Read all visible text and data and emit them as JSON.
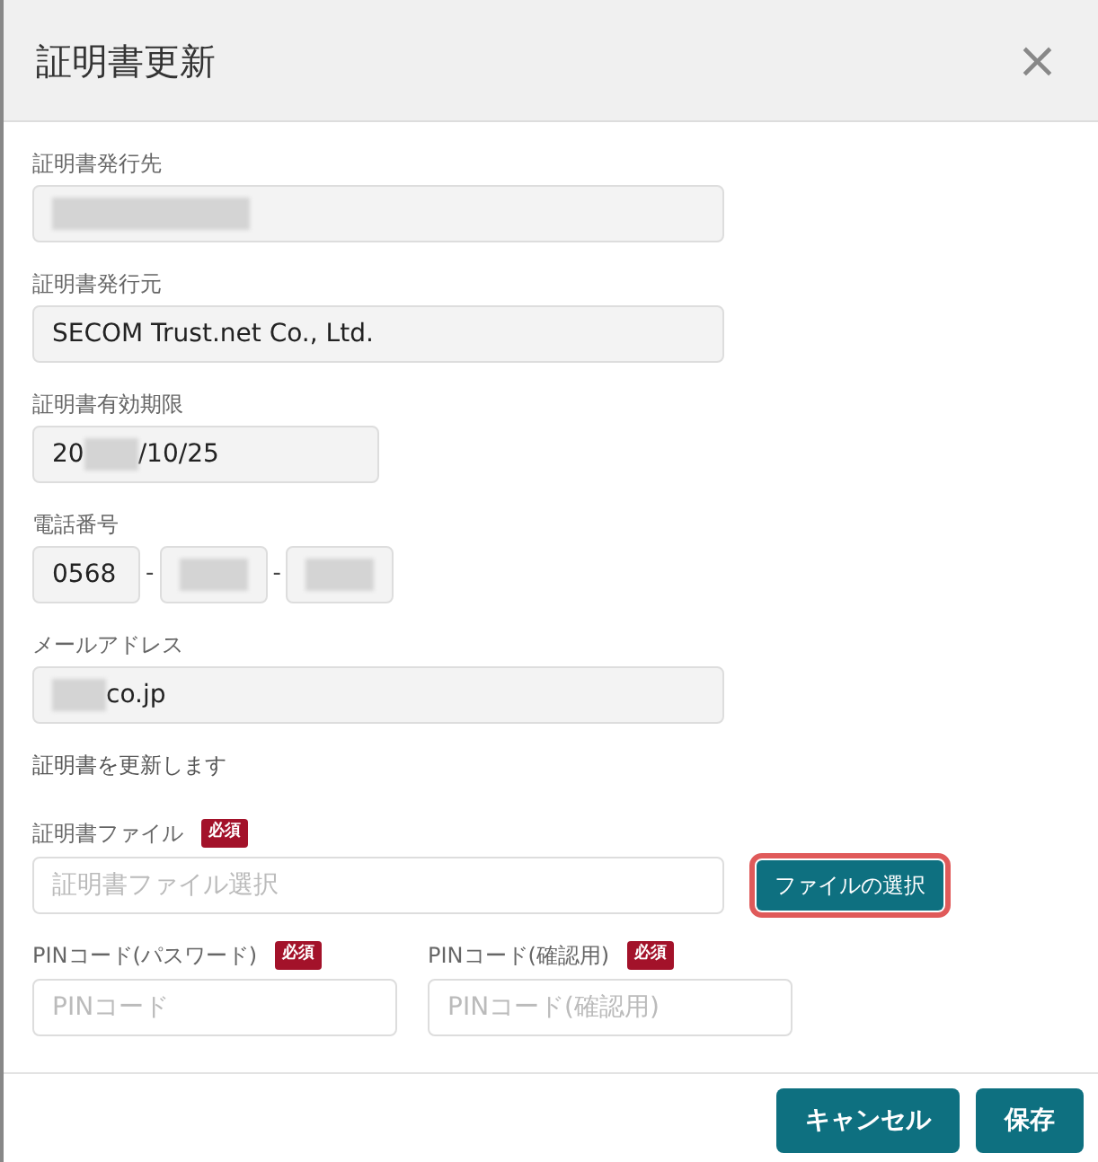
{
  "dialog": {
    "title": "証明書更新",
    "close": "×"
  },
  "fields": [
    {
      "kind": "text",
      "label": "証明書発行先",
      "segments": [
        {
          "redacted": true
        }
      ]
    },
    {
      "kind": "text",
      "label": "証明書発行元",
      "segments": [
        {
          "text": "SECOM Trust.net Co., Ltd."
        }
      ]
    },
    {
      "kind": "date",
      "label": "証明書有効期限",
      "segments": [
        {
          "text": "20"
        },
        {
          "redacted": true
        },
        {
          "text": "/10/25"
        }
      ]
    },
    {
      "kind": "phone",
      "label": "電話番号",
      "parts": [
        {
          "segments": [
            {
              "text": "0568"
            }
          ]
        },
        {
          "segments": [
            {
              "redacted": true
            }
          ]
        },
        {
          "segments": [
            {
              "redacted": true
            }
          ]
        }
      ],
      "separators": [
        "-",
        "-"
      ]
    },
    {
      "kind": "text",
      "label": "メールアドレス",
      "segments": [
        {
          "redacted": true
        },
        {
          "text": "co.jp"
        }
      ]
    }
  ],
  "note": "証明書を更新します",
  "upload": {
    "label": "証明書ファイル",
    "required": "必須",
    "placeholder": "証明書ファイル選択",
    "button": "ファイルの選択",
    "highlighted": true
  },
  "pins": [
    {
      "label": "PINコード(パスワード)",
      "required": "必須",
      "placeholder": "PINコード"
    },
    {
      "label": "PINコード(確認用)",
      "required": "必須",
      "placeholder": "PINコード(確認用)"
    }
  ],
  "buttons": [
    {
      "label": "キャンセル"
    },
    {
      "label": "保存"
    }
  ]
}
